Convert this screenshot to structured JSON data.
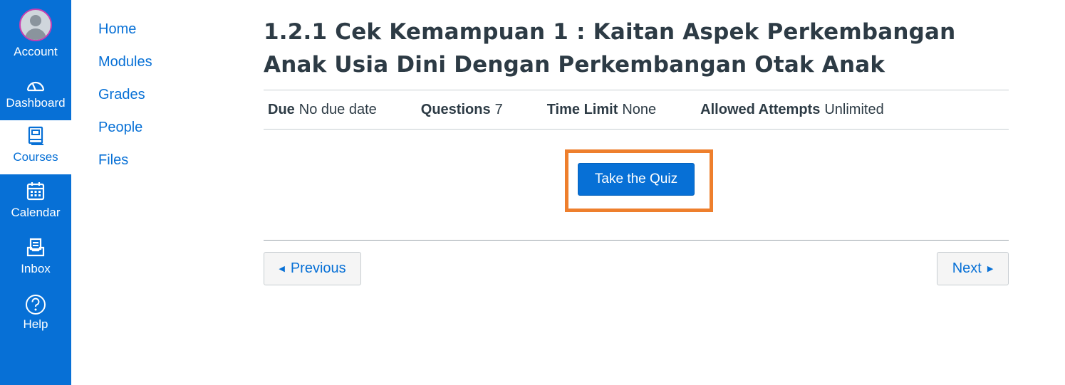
{
  "global_nav": {
    "items": [
      {
        "label": "Account",
        "icon": "avatar"
      },
      {
        "label": "Dashboard",
        "icon": "dashboard-icon"
      },
      {
        "label": "Courses",
        "icon": "courses-icon",
        "active": true
      },
      {
        "label": "Calendar",
        "icon": "calendar-icon"
      },
      {
        "label": "Inbox",
        "icon": "inbox-icon"
      },
      {
        "label": "Help",
        "icon": "help-icon"
      }
    ]
  },
  "course_nav": {
    "links": [
      "Home",
      "Modules",
      "Grades",
      "People",
      "Files"
    ]
  },
  "quiz": {
    "title": "1.2.1 Cek Kemampuan 1 : Kaitan Aspek Perkembangan Anak Usia Dini Dengan Perkembangan Otak Anak",
    "details": {
      "due_label": "Due",
      "due_value": "No due date",
      "questions_label": "Questions",
      "questions_value": "7",
      "time_limit_label": "Time Limit",
      "time_limit_value": "None",
      "attempts_label": "Allowed Attempts",
      "attempts_value": "Unlimited"
    },
    "take_button": "Take the Quiz"
  },
  "pager": {
    "previous": "Previous",
    "next": "Next"
  },
  "colors": {
    "nav_bg": "#0770d6",
    "link": "#0770d6",
    "highlight": "#ee7f2d",
    "text": "#2d3b45"
  }
}
